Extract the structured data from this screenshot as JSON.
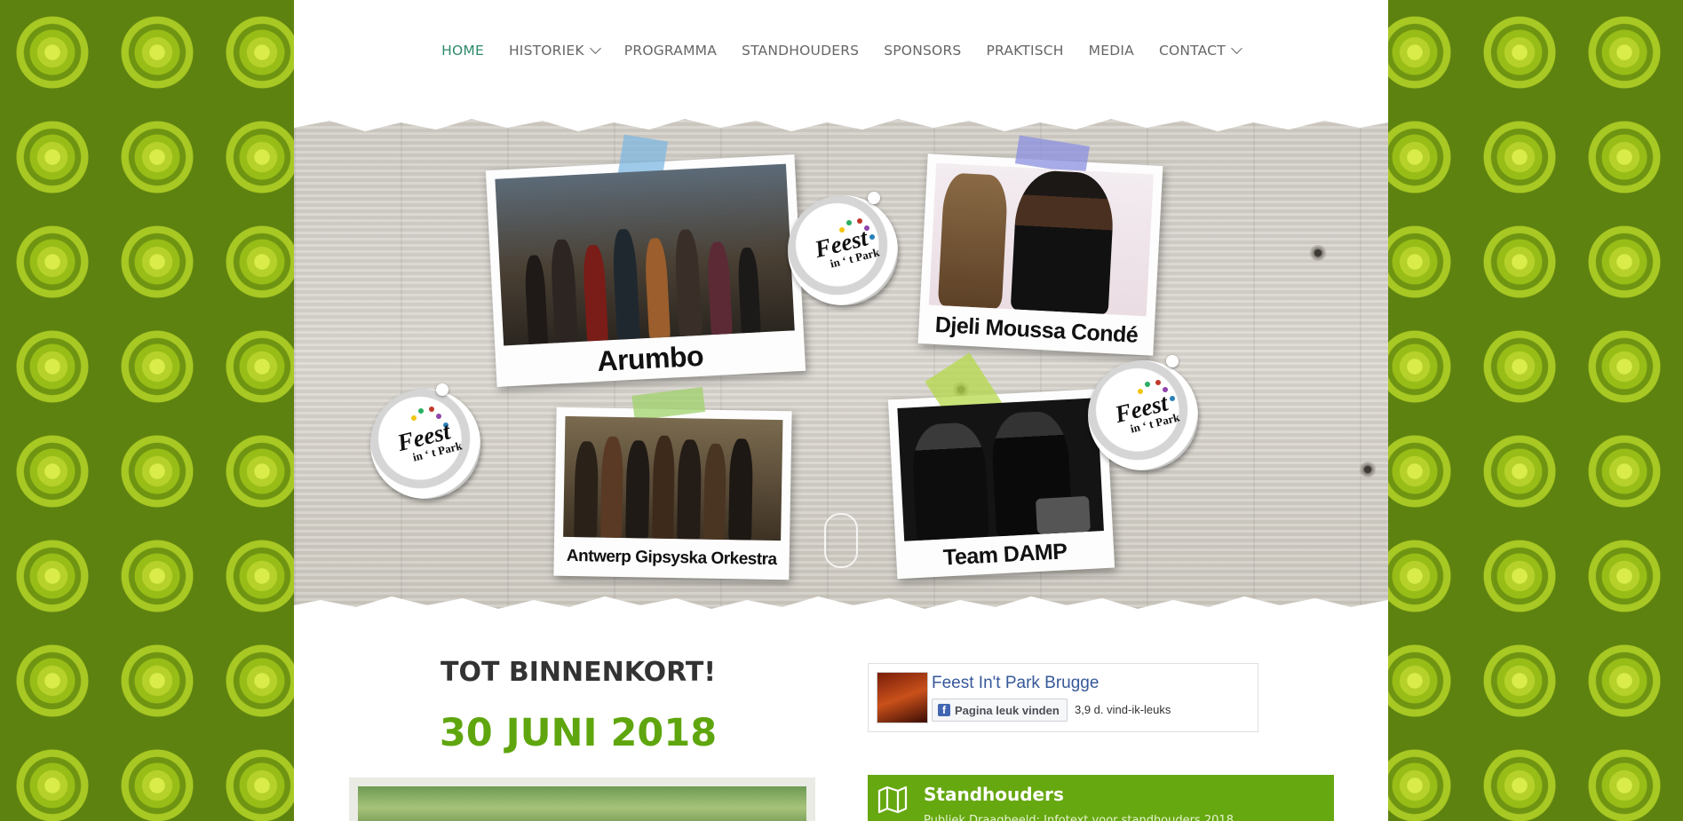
{
  "nav": {
    "items": [
      {
        "label": "HOME",
        "active": true,
        "dropdown": false
      },
      {
        "label": "HISTORIEK",
        "active": false,
        "dropdown": true
      },
      {
        "label": "PROGRAMMA",
        "active": false,
        "dropdown": false
      },
      {
        "label": "STANDHOUDERS",
        "active": false,
        "dropdown": false
      },
      {
        "label": "SPONSORS",
        "active": false,
        "dropdown": false
      },
      {
        "label": "PRAKTISCH",
        "active": false,
        "dropdown": false
      },
      {
        "label": "MEDIA",
        "active": false,
        "dropdown": false
      },
      {
        "label": "CONTACT",
        "active": false,
        "dropdown": true
      }
    ]
  },
  "hero": {
    "acts": [
      {
        "name": "Arumbo"
      },
      {
        "name": "Djeli Moussa Condé"
      },
      {
        "name": "Antwerp Gipsyska Orkestra"
      },
      {
        "name": "Team DAMP"
      }
    ],
    "badge": {
      "line1": "Feest",
      "line2": "in ‘ t Park"
    }
  },
  "main": {
    "heading": "TOT BINNENKORT!",
    "date": "30 JUNI 2018"
  },
  "facebook": {
    "page_name": "Feest In't Park Brugge",
    "like_button": "Pagina leuk vinden",
    "likes": "3,9 d. vind-ik-leuks"
  },
  "standhouders": {
    "title": "Standhouders",
    "subtitle": "Publiek Draagbeeld: Infotext voor standhouders 2018"
  },
  "colors": {
    "accent_green": "#66a810",
    "date_green": "#5fa60e",
    "nav_active": "#2e8a6c",
    "facebook_blue": "#365899"
  }
}
